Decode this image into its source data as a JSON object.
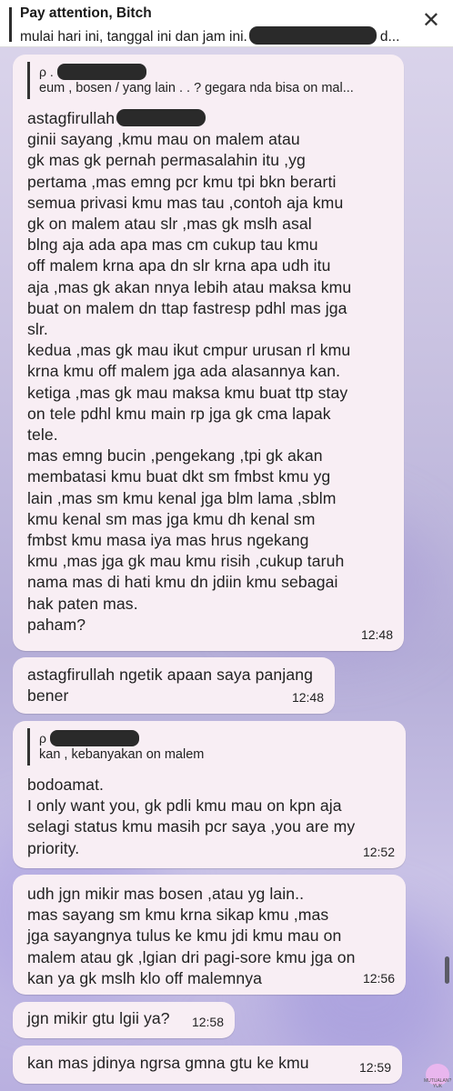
{
  "pinned": {
    "title": "Pay attention, Bitch",
    "text_start": "mulai hari ini, tanggal ini dan jam ini.",
    "text_end": "d..."
  },
  "messages": [
    {
      "reply_prefix": "ρ .",
      "reply_text": "eum , bosen / yang lain . .  ? gegara nda bisa on mal...",
      "first_line": "astagfirullah",
      "body": "ginii sayang ,kmu mau on malem atau\ngk mas gk pernah permasalahin itu ,yg\npertama ,mas emng pcr kmu tpi bkn berarti\nsemua privasi kmu mas tau ,contoh aja kmu\ngk on malem atau slr ,mas gk mslh asal\nblng aja ada apa mas cm cukup tau kmu\noff malem krna apa dn slr krna apa udh itu\naja ,mas gk akan nnya lebih atau maksa kmu\nbuat on malem dn ttap fastresp pdhl mas jga\nslr.\nkedua ,mas gk mau ikut cmpur urusan rl kmu\nkrna kmu off malem jga ada alasannya kan.\nketiga ,mas gk mau maksa kmu buat ttp stay\non tele pdhl kmu main rp jga gk cma lapak\ntele.\nmas emng bucin ,pengekang ,tpi gk akan\nmembatasi kmu buat dkt sm fmbst kmu yg\nlain ,mas sm kmu kenal jga blm lama ,sblm\nkmu kenal sm mas jga kmu dh kenal sm\nfmbst kmu masa iya mas hrus ngekang\nkmu ,mas jga gk mau kmu risih ,cukup taruh\nnama mas di hati kmu dn jdiin kmu sebagai\nhak paten mas.\npaham?",
      "time": "12:48"
    },
    {
      "body": "astagfirullah ngetik apaan saya panjang\nbener",
      "time": "12:48"
    },
    {
      "reply_prefix": "ρ",
      "reply_text": "kan , kebanyakan on malem",
      "body": "bodoamat.\nI only want you, gk pdli kmu mau on kpn aja\nselagi status kmu masih pcr saya ,you are my\npriority.",
      "time": "12:52"
    },
    {
      "body": "udh jgn mikir mas bosen ,atau yg lain..\nmas sayang sm kmu krna sikap kmu ,mas\njga sayangnya tulus ke kmu jdi kmu mau on\nmalem atau gk ,lgian dri pagi-sore kmu jga on\nkan ya gk mslh klo off malemnya",
      "time": "12:56"
    },
    {
      "body": "jgn mikir gtu lgii ya?",
      "time": "12:58"
    },
    {
      "body": "kan mas jdinya ngrsa gmna gtu ke kmu",
      "time": "12:59"
    }
  ],
  "watermark": "MUTUALAN? YUK"
}
